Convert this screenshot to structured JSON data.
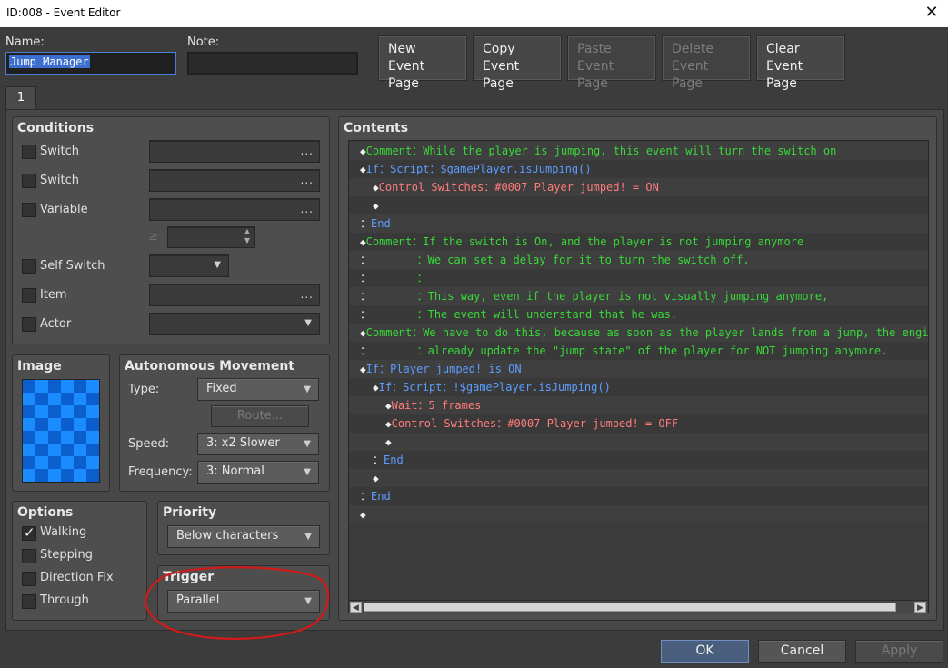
{
  "window": {
    "title": "ID:008 - Event Editor",
    "close_glyph": "✕"
  },
  "header": {
    "name_label": "Name:",
    "name_value": "Jump Manager",
    "note_label": "Note:",
    "note_value": "",
    "buttons": [
      {
        "line1": "New",
        "line2": "Event Page",
        "enabled": true
      },
      {
        "line1": "Copy",
        "line2": "Event Page",
        "enabled": true
      },
      {
        "line1": "Paste",
        "line2": "Event Page",
        "enabled": false
      },
      {
        "line1": "Delete",
        "line2": "Event Page",
        "enabled": false
      },
      {
        "line1": "Clear",
        "line2": "Event Page",
        "enabled": true
      }
    ]
  },
  "tabs": [
    {
      "label": "1"
    }
  ],
  "conditions": {
    "title": "Conditions",
    "switch1_label": "Switch",
    "switch2_label": "Switch",
    "variable_label": "Variable",
    "gte_symbol": "≥",
    "self_switch_label": "Self Switch",
    "item_label": "Item",
    "actor_label": "Actor",
    "ellipsis": "..."
  },
  "image_panel": {
    "title": "Image"
  },
  "movement": {
    "title": "Autonomous Movement",
    "type_label": "Type:",
    "type_value": "Fixed",
    "route_label": "Route...",
    "speed_label": "Speed:",
    "speed_value": "3: x2 Slower",
    "frequency_label": "Frequency:",
    "frequency_value": "3: Normal"
  },
  "options": {
    "title": "Options",
    "walking_label": "Walking",
    "walking_checked": true,
    "stepping_label": "Stepping",
    "direction_fix_label": "Direction Fix",
    "through_label": "Through"
  },
  "priority": {
    "title": "Priority",
    "value": "Below characters"
  },
  "trigger": {
    "title": "Trigger",
    "value": "Parallel"
  },
  "contents": {
    "title": "Contents",
    "lines": [
      {
        "prefix": "◆",
        "text": "Comment：While the player is jumping, this event will turn the switch on",
        "color": "green",
        "indent": 0
      },
      {
        "prefix": "◆",
        "text": "If：Script：$gamePlayer.isJumping()",
        "color": "blue",
        "indent": 0
      },
      {
        "prefix": "◆",
        "text": "Control Switches：#0007 Player jumped! = ON",
        "color": "red",
        "indent": 1
      },
      {
        "prefix": "◆",
        "text": "",
        "color": "white",
        "indent": 1
      },
      {
        "prefix": "：",
        "text": "End",
        "color": "blue",
        "indent": 0
      },
      {
        "prefix": "◆",
        "text": "Comment：If the switch is On, and the player is not jumping anymore",
        "color": "green",
        "indent": 0
      },
      {
        "prefix": "：",
        "text": "       ：We can set a delay for it to turn the switch off.",
        "color": "green",
        "indent": 0
      },
      {
        "prefix": "：",
        "text": "       ：",
        "color": "green",
        "indent": 0
      },
      {
        "prefix": "：",
        "text": "       ：This way, even if the player is not visually jumping anymore,",
        "color": "green",
        "indent": 0
      },
      {
        "prefix": "：",
        "text": "       ：The event will understand that he was.",
        "color": "green",
        "indent": 0
      },
      {
        "prefix": "◆",
        "text": "Comment：We have to do this, because as soon as the player lands from a jump, the engine",
        "color": "green",
        "indent": 0
      },
      {
        "prefix": "：",
        "text": "       ：already update the \"jump state\" of the player for NOT jumping anymore.",
        "color": "green",
        "indent": 0
      },
      {
        "prefix": "◆",
        "text": "If：Player jumped! is ON",
        "color": "blue",
        "indent": 0
      },
      {
        "prefix": "◆",
        "text": "If：Script：!$gamePlayer.isJumping()",
        "color": "blue",
        "indent": 1
      },
      {
        "prefix": "◆",
        "text": "Wait：5 frames",
        "color": "red",
        "indent": 2
      },
      {
        "prefix": "◆",
        "text": "Control Switches：#0007 Player jumped! = OFF",
        "color": "red",
        "indent": 2
      },
      {
        "prefix": "◆",
        "text": "",
        "color": "white",
        "indent": 2
      },
      {
        "prefix": "：",
        "text": "End",
        "color": "blue",
        "indent": 1
      },
      {
        "prefix": "◆",
        "text": "",
        "color": "white",
        "indent": 1
      },
      {
        "prefix": "：",
        "text": "End",
        "color": "blue",
        "indent": 0
      },
      {
        "prefix": "◆",
        "text": "",
        "color": "white",
        "indent": 0
      }
    ]
  },
  "footer": {
    "ok": "OK",
    "cancel": "Cancel",
    "apply": "Apply"
  },
  "colors": {
    "annotation": "#d11a1a",
    "accent": "#4a7fd6",
    "image_tile_a": "#1a8cff",
    "image_tile_b": "#0a5fcc"
  }
}
